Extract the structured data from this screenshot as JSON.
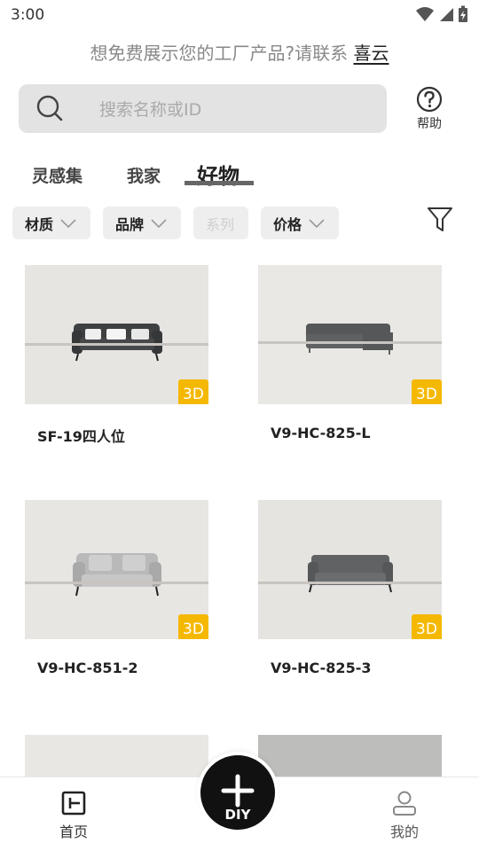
{
  "status_bar": {
    "time": "3:00"
  },
  "promo": {
    "text": "想免费展示您的工厂产品?请联系 ",
    "link": "喜云"
  },
  "search": {
    "placeholder": "搜索名称或ID"
  },
  "help": {
    "label": "帮助"
  },
  "tabs": [
    {
      "label": "灵感集",
      "active": false
    },
    {
      "label": "我家",
      "active": false
    },
    {
      "label": "好物",
      "active": true
    }
  ],
  "filters": [
    {
      "label": "材质",
      "enabled": true
    },
    {
      "label": "品牌",
      "enabled": true
    },
    {
      "label": "系列",
      "enabled": false
    },
    {
      "label": "价格",
      "enabled": true
    }
  ],
  "products": [
    {
      "name": "SF-19四人位",
      "badge": "3D"
    },
    {
      "name": "V9-HC-825-L",
      "badge": "3D"
    },
    {
      "name": "V9-HC-851-2",
      "badge": "3D"
    },
    {
      "name": "V9-HC-825-3",
      "badge": "3D"
    }
  ],
  "bottom_nav": {
    "home": "首页",
    "diy": "DIY",
    "mine": "我的"
  },
  "colors": {
    "badge": "#f5b800",
    "search_bg": "#e3e3e3",
    "chip_bg": "#eeeeee"
  }
}
